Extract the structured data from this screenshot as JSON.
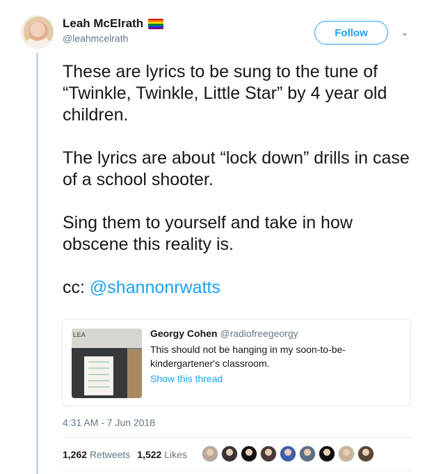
{
  "author": {
    "name": "Leah McElrath",
    "handle": "@leahmcelrath",
    "flag_colors": [
      "#e40303",
      "#ff8c00",
      "#ffed00",
      "#008026",
      "#004dff",
      "#750787"
    ]
  },
  "actions": {
    "follow_label": "Follow",
    "menu_icon": "chevron-down-icon",
    "menu_glyph": "⌄"
  },
  "tweet": {
    "paragraphs": [
      "These are lyrics to be sung to the tune of “Twinkle, Twinkle, Little Star” by 4 year old children.",
      "The lyrics are about “lock down” drills in case of a school shooter.",
      "Sing them to yourself and take in how obscene this reality is."
    ],
    "cc_prefix": "cc: ",
    "cc_mention": "@shannonrwatts"
  },
  "quoted_tweet": {
    "name": "Georgy Cohen",
    "handle": "@radiofreegeorgy",
    "text": "This should not be hanging in my soon-to-be-kindergartener's classroom.",
    "link": "Show this thread",
    "thumb_sign": "LEA"
  },
  "timestamp": "4:31 AM - 7 Jun 2018",
  "stats": {
    "retweets_count": "1,262",
    "retweets_label": "Retweets",
    "likes_count": "1,522",
    "likes_label": "Likes"
  },
  "liker_avatar_colors": [
    "#b9a89a",
    "#3a3230",
    "#111111",
    "#4a3a36",
    "#3f5ea8",
    "#5a6f86",
    "#0f0f0f",
    "#c9b39a",
    "#5b4636"
  ],
  "colors": {
    "accent": "#1da1f2",
    "text": "#14171a",
    "secondary": "#657786",
    "thread_line": "#c7d6f3"
  }
}
